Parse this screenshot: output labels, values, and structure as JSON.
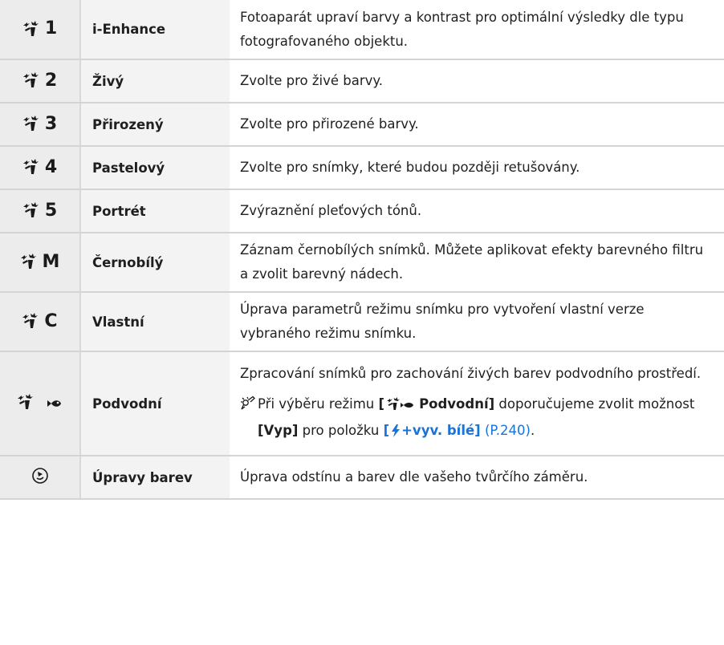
{
  "rows": [
    {
      "icon": "picture-mode-icon",
      "num": "1",
      "name": "i-Enhance",
      "desc": "Fotoaparát upraví barvy a kontrast pro optimální výsledky dle typu fotografovaného objektu."
    },
    {
      "icon": "picture-mode-icon",
      "num": "2",
      "name": "Živý",
      "desc": "Zvolte pro živé barvy."
    },
    {
      "icon": "picture-mode-icon",
      "num": "3",
      "name": "Přirozený",
      "desc": "Zvolte pro přirozené barvy."
    },
    {
      "icon": "picture-mode-icon",
      "num": "4",
      "name": "Pastelový",
      "desc": "Zvolte pro snímky, které budou později retušovány."
    },
    {
      "icon": "picture-mode-icon",
      "num": "5",
      "name": "Portrét",
      "desc": "Zvýraznění pleťových tónů."
    },
    {
      "icon": "picture-mode-icon",
      "num": "M",
      "name": "Černobílý",
      "desc": "Záznam černobílých snímků. Můžete aplikovat efekty barevného filtru a zvolit barevný nádech."
    },
    {
      "icon": "picture-mode-icon",
      "num": "C",
      "name": "Vlastní",
      "desc": "Úprava parametrů režimu snímku pro vytvoření vlastní verze vybraného režimu snímku."
    },
    {
      "icon": "underwater-picture-mode-icon",
      "num": "",
      "name": "Podvodní",
      "desc": "Zpracování snímků pro zachování živých barev podvodního prostředí."
    },
    {
      "icon": "color-creator-dial-icon",
      "num": "",
      "name": "Úpravy barev",
      "desc": "Úprava odstínu a barev dle vašeho tvůrčího záměru."
    }
  ],
  "note": {
    "icon": "tip-pencil-icon",
    "t1": "Při výběru režimu ",
    "b1_open": "[",
    "b1_label": "Podvodní]",
    "t2": " doporučujeme zvolit možnost ",
    "b2": "[Vyp]",
    "t3": " pro položku ",
    "blue_open": "[",
    "blue_label": "+vyv. bílé]",
    "link": "(P.240)",
    "end": "."
  },
  "colors": {
    "accent": "#1a73d9",
    "icon_cell": "#ececec",
    "name_cell": "#f3f3f3",
    "border": "#d4d4d4"
  }
}
